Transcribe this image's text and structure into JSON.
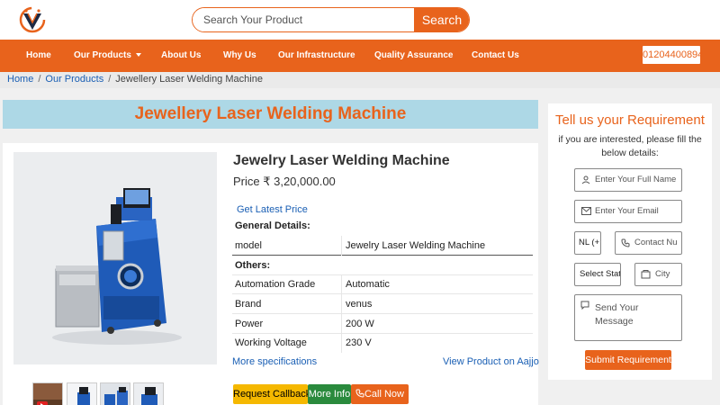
{
  "header": {
    "logo_name": "brand-logo",
    "search": {
      "placeholder": "Search Your Product",
      "button_label": "Search"
    },
    "nav": [
      {
        "label": "Home"
      },
      {
        "label": "Our Products"
      },
      {
        "label": "About Us"
      },
      {
        "label": "Why Us"
      },
      {
        "label": "Our Infrastructure"
      },
      {
        "label": "Quality Assurance"
      },
      {
        "label": "Contact Us"
      }
    ],
    "phone": "01204400894"
  },
  "breadcrumb": {
    "home": "Home",
    "products": "Our Products",
    "current": "Jewellery Laser Welding Machine"
  },
  "page_title": "Jewellery Laser Welding Machine",
  "product": {
    "name": "Jewelry Laser Welding Machine",
    "price": "Price ₹ 3,20,000.00",
    "latest_price_link": "Get Latest Price",
    "general_heading": "General Details:",
    "general": [
      {
        "key": "model",
        "value": "Jewelry Laser Welding Machine"
      }
    ],
    "others_heading": "Others:",
    "others": [
      {
        "key": "Automation Grade",
        "value": "Automatic"
      },
      {
        "key": "Brand",
        "value": "venus"
      },
      {
        "key": "Power",
        "value": "200 W"
      },
      {
        "key": "Working Voltage",
        "value": "230 V"
      }
    ],
    "more_specs": "More specifications",
    "view_on_aajjo": "View Product on Aajjo",
    "buttons": {
      "callback": "Request Callback",
      "more_info": "More Info",
      "call_now": "Call Now"
    }
  },
  "requirement_form": {
    "title": "Tell us your Requirement",
    "subtitle": "if you are interested, please fill the below details:",
    "name_placeholder": "Enter Your Full Name",
    "email_placeholder": "Enter Your Email",
    "country_code": "NL (+",
    "contact_placeholder": "Contact Nu",
    "state_select": "Select Stat",
    "city_placeholder": "City",
    "message_placeholder": "Send Your Message",
    "submit_label": "Submit Requirement"
  },
  "colors": {
    "brand_orange": "#e8631c",
    "title_banner_bg": "#add8e6",
    "link_blue": "#1a5fb4",
    "callback_yellow": "#f5b800",
    "more_info_green": "#2a8a3d"
  }
}
